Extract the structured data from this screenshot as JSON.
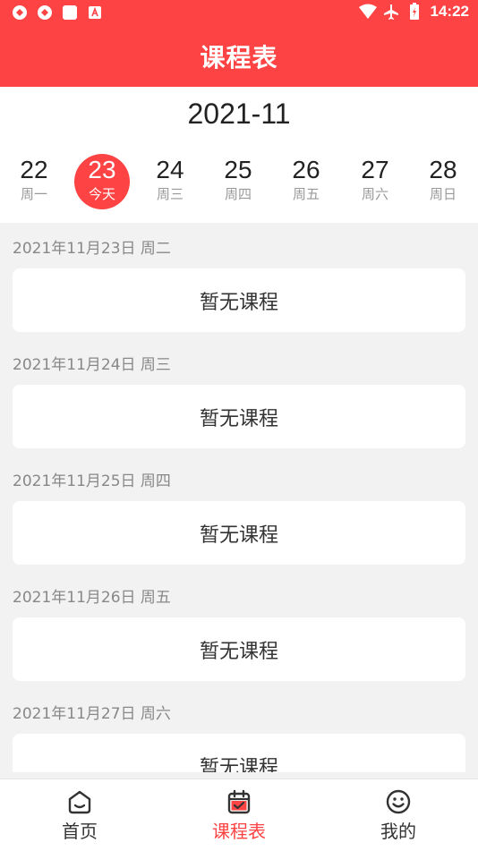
{
  "status_bar": {
    "time": "14:22",
    "left_icons": [
      "app-icon",
      "app-icon",
      "square-icon",
      "font-icon"
    ],
    "right_icons": [
      "wifi-icon",
      "airplane-icon",
      "battery-icon"
    ]
  },
  "header": {
    "title": "课程表"
  },
  "calendar": {
    "month": "2021-11",
    "days": [
      {
        "num": "22",
        "label": "周一",
        "selected": false
      },
      {
        "num": "23",
        "label": "今天",
        "selected": true
      },
      {
        "num": "24",
        "label": "周三",
        "selected": false
      },
      {
        "num": "25",
        "label": "周四",
        "selected": false
      },
      {
        "num": "26",
        "label": "周五",
        "selected": false
      },
      {
        "num": "27",
        "label": "周六",
        "selected": false
      },
      {
        "num": "28",
        "label": "周日",
        "selected": false
      }
    ]
  },
  "schedule": [
    {
      "date": "2021年11月23日 周二",
      "course": "暂无课程"
    },
    {
      "date": "2021年11月24日 周三",
      "course": "暂无课程"
    },
    {
      "date": "2021年11月25日 周四",
      "course": "暂无课程"
    },
    {
      "date": "2021年11月26日 周五",
      "course": "暂无课程"
    },
    {
      "date": "2021年11月27日 周六",
      "course": "暂无课程"
    }
  ],
  "bottom_nav": [
    {
      "label": "首页",
      "icon": "home-icon",
      "active": false
    },
    {
      "label": "课程表",
      "icon": "calendar-check-icon",
      "active": true
    },
    {
      "label": "我的",
      "icon": "smiley-icon",
      "active": false
    }
  ],
  "colors": {
    "accent": "#fd4343",
    "background": "#f2f2f2",
    "card": "#ffffff"
  }
}
